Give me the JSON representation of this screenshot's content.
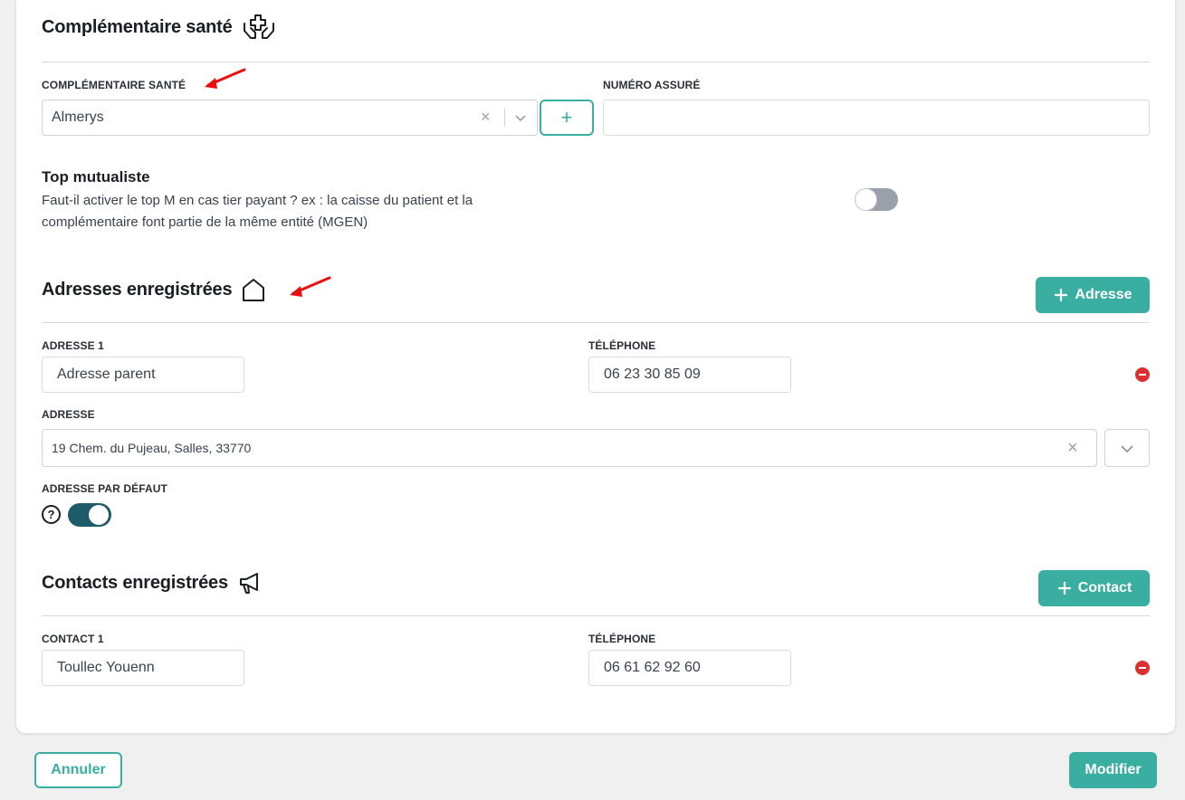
{
  "health": {
    "title": "Complémentaire santé",
    "icon": "hands-medical-icon",
    "insurer_label": "COMPLÉMENTAIRE SANTÉ",
    "insurer_value": "Almerys",
    "insurer_clear": "×",
    "insured_number_label": "NUMÉRO ASSURÉ",
    "insured_number_value": "",
    "add_insurer": "+"
  },
  "top_mutualiste": {
    "title": "Top mutualiste",
    "description_line1": "Faut-il activer le top M en cas tier payant ? ex : la caisse du patient et la",
    "description_line2": "complémentaire font partie de la même entité (MGEN)",
    "enabled": false
  },
  "addresses": {
    "title": "Adresses enregistrées",
    "icon": "house-icon",
    "add_button": "Adresse",
    "items": [
      {
        "name_label": "ADRESSE 1",
        "name_value": "Adresse parent",
        "phone_label": "TÉLÉPHONE",
        "phone_value": "06 23 30 85 09",
        "address_label": "ADRESSE",
        "address_value": "19 Chem. du Pujeau, Salles, 33770",
        "address_clear": "×",
        "default_label": "ADRESSE PAR DÉFAUT",
        "default_help": "?",
        "default_enabled": true
      }
    ]
  },
  "contacts": {
    "title": "Contacts enregistrées",
    "icon": "megaphone-icon",
    "add_button": "Contact",
    "items": [
      {
        "name_label": "CONTACT 1",
        "name_value": "Toullec Youenn",
        "phone_label": "TÉLÉPHONE",
        "phone_value": "06 61 62 92 60"
      }
    ]
  },
  "footer": {
    "cancel": "Annuler",
    "submit": "Modifier"
  },
  "colors": {
    "primary": "#3aaea0",
    "toggle_on": "#1d5b6b",
    "toggle_off": "#9aa0aa",
    "danger": "#dc2f2f",
    "annotation_arrow": "#e8100f"
  }
}
